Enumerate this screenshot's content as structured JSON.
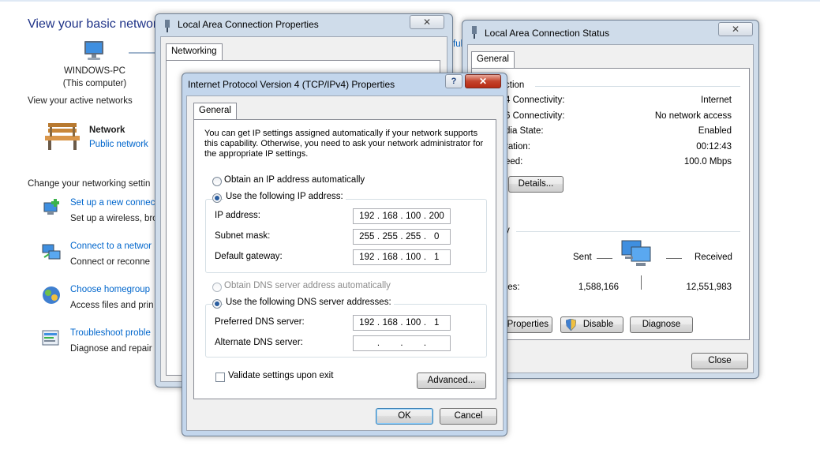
{
  "background": {
    "title": "View your basic network",
    "computer_name": "WINDOWS-PC",
    "computer_sub": "(This computer)",
    "active_networks_label": "View your active networks",
    "network_name": "Network",
    "network_type": "Public network",
    "change_settings_label": "Change your networking settin",
    "partial_link": "ful",
    "tasks": [
      {
        "link": "Set up a new connec",
        "desc": "Set up a wireless, bro"
      },
      {
        "link": "Connect to a networ",
        "desc": "Connect or reconne"
      },
      {
        "link": "Choose homegroup",
        "desc": "Access files and prin"
      },
      {
        "link": "Troubleshoot proble",
        "desc": "Diagnose and repair"
      }
    ]
  },
  "lac_properties": {
    "title": "Local Area Connection Properties",
    "close": "✕",
    "tab": "Networking"
  },
  "lac_status": {
    "title": "Local Area Connection Status",
    "close": "✕",
    "tab": "General",
    "connection_heading": "ction",
    "rows": [
      {
        "label": "4 Connectivity:",
        "value": "Internet"
      },
      {
        "label": "6 Connectivity:",
        "value": "No network access"
      },
      {
        "label": "dia State:",
        "value": "Enabled"
      },
      {
        "label": "ration:",
        "value": "00:12:43"
      },
      {
        "label": "eed:",
        "value": "100.0 Mbps"
      }
    ],
    "details_button": "Details...",
    "activity_heading": "y",
    "sent_label": "Sent",
    "received_label": "Received",
    "bytes_label": "tes:",
    "sent_value": "1,588,166",
    "received_value": "12,551,983",
    "properties_button": "Properties",
    "disable_button": "Disable",
    "diagnose_button": "Diagnose",
    "close_button": "Close"
  },
  "ipv4": {
    "title": "Internet Protocol Version 4 (TCP/IPv4) Properties",
    "help": "?",
    "close": "✕",
    "tab": "General",
    "intro": "You can get IP settings assigned automatically if your network supports this capability. Otherwise, you need to ask your network administrator for the appropriate IP settings.",
    "obtain_ip_auto": "Obtain an IP address automatically",
    "use_following_ip": "Use the following IP address:",
    "ip_address_label": "IP address:",
    "ip_address": [
      "192",
      "168",
      "100",
      "200"
    ],
    "subnet_mask_label": "Subnet mask:",
    "subnet_mask": [
      "255",
      "255",
      "255",
      "0"
    ],
    "gateway_label": "Default gateway:",
    "gateway": [
      "192",
      "168",
      "100",
      "1"
    ],
    "obtain_dns_auto": "Obtain DNS server address automatically",
    "use_following_dns": "Use the following DNS server addresses:",
    "preferred_dns_label": "Preferred DNS server:",
    "preferred_dns": [
      "192",
      "168",
      "100",
      "1"
    ],
    "alternate_dns_label": "Alternate DNS server:",
    "alternate_dns": [
      "",
      "",
      "",
      ""
    ],
    "validate_label": "Validate settings upon exit",
    "validate_checked": false,
    "advanced_button": "Advanced...",
    "ok_button": "OK",
    "cancel_button": "Cancel"
  },
  "colors": {
    "link": "#0066cc",
    "title_blue": "#1e3287",
    "frame": "#cfdcea",
    "close_red": "#c4432c"
  }
}
